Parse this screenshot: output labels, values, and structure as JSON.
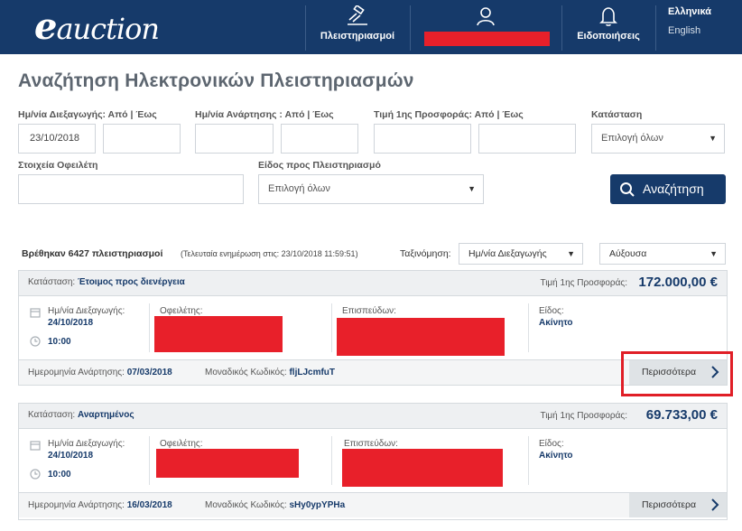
{
  "header": {
    "logo_e": "e",
    "logo_rest": "auction",
    "nav_auctions": "Πλειστηριασμοί",
    "nav_notifications": "Ειδοποιήσεις",
    "lang_el": "Ελληνικά",
    "lang_en": "English"
  },
  "page_title": "Αναζήτηση Ηλεκτρονικών Πλειστηριασμών",
  "filters": {
    "auction_date_label": "Ημ/νία Διεξαγωγής: Από | Έως",
    "auction_date_from": "23/10/2018",
    "auction_date_to": "",
    "posting_date_label": "Ημ/νία Ανάρτησης : Από | Έως",
    "posting_date_from": "",
    "posting_date_to": "",
    "price_label": "Τιμή 1ης Προσφοράς: Από | Έως",
    "price_from": "",
    "price_to": "",
    "status_label": "Κατάσταση",
    "status_value": "Επιλογή όλων",
    "debtor_label": "Στοιχεία Οφειλέτη",
    "debtor_value": "",
    "type_label": "Είδος προς Πλειστηριασμό",
    "type_value": "Επιλογή όλων",
    "search_button": "Αναζήτηση"
  },
  "results": {
    "count_text": "Βρέθηκαν 6427 πλειστηριασμοί",
    "last_update": "(Τελευταία ενημέρωση στις: 23/10/2018 11:59:51)",
    "sort_label": "Ταξινόμηση:",
    "sort_field": "Ημ/νία Διεξαγωγής",
    "sort_order": "Αύξουσα"
  },
  "cards": [
    {
      "status_label": "Κατάσταση:",
      "status": "Έτοιμος προς διενέργεια",
      "price_label": "Τιμή 1ης Προσφοράς:",
      "price": "172.000,00 €",
      "date_label": "Ημ/νία Διεξαγωγής:",
      "date": "24/10/2018",
      "time": "10:00",
      "debtor_label": "Οφειλέτης:",
      "creditor_label": "Επισπεύδων:",
      "kind_label": "Είδος:",
      "kind": "Ακίνητο",
      "posting_label": "Ημερομηνία Ανάρτησης:",
      "posting_date": "07/03/2018",
      "code_label": "Μοναδικός Κωδικός:",
      "code": "fljLJcmfuT",
      "more": "Περισσότερα"
    },
    {
      "status_label": "Κατάσταση:",
      "status": "Αναρτημένος",
      "price_label": "Τιμή 1ης Προσφοράς:",
      "price": "69.733,00 €",
      "date_label": "Ημ/νία Διεξαγωγής:",
      "date": "24/10/2018",
      "time": "10:00",
      "debtor_label": "Οφειλέτης:",
      "creditor_label": "Επισπεύδων:",
      "kind_label": "Είδος:",
      "kind": "Ακίνητο",
      "posting_label": "Ημερομηνία Ανάρτησης:",
      "posting_date": "16/03/2018",
      "code_label": "Μοναδικός Κωδικός:",
      "code": "sHy0ypYPHa",
      "more": "Περισσότερα"
    }
  ],
  "colors": {
    "navy": "#163a6a",
    "redaction": "#e8202a",
    "highlight": "#e01e26"
  }
}
